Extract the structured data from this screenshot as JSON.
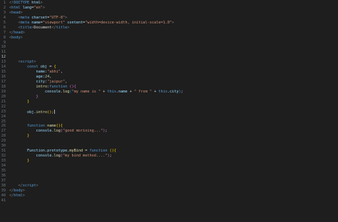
{
  "editor": {
    "active_line": 12,
    "line_numbers": [
      "1",
      "2",
      "3",
      "4",
      "5",
      "6",
      "7",
      "8",
      "9",
      "10",
      "11",
      "12",
      "13",
      "14",
      "15",
      "16",
      "17",
      "18",
      "19",
      "20",
      "21",
      "22",
      "23",
      "24",
      "25",
      "26",
      "27",
      "28",
      "29",
      "30",
      "31",
      "32",
      "33",
      "34",
      "35",
      "36",
      "37",
      "38",
      "39",
      "40",
      "41"
    ],
    "colors": {
      "background": "#1e1e1e",
      "tag": "#569cd6",
      "attribute": "#9cdcfe",
      "string": "#ce9178",
      "function": "#dcdcaa",
      "number": "#b5cea8"
    }
  },
  "code_lines": [
    [
      {
        "t": "<!",
        "c": "bracket"
      },
      {
        "t": "DOCTYPE",
        "c": "tag"
      },
      {
        "t": " ",
        "c": "punc"
      },
      {
        "t": "html",
        "c": "attr"
      },
      {
        "t": ">",
        "c": "bracket"
      }
    ],
    [
      {
        "t": "<",
        "c": "bracket"
      },
      {
        "t": "html",
        "c": "tag"
      },
      {
        "t": " ",
        "c": "punc"
      },
      {
        "t": "lang",
        "c": "attr"
      },
      {
        "t": "=",
        "c": "punc"
      },
      {
        "t": "\"en\"",
        "c": "str"
      },
      {
        "t": ">",
        "c": "bracket"
      }
    ],
    [
      {
        "t": "<",
        "c": "bracket"
      },
      {
        "t": "head",
        "c": "tag"
      },
      {
        "t": ">",
        "c": "bracket"
      }
    ],
    [
      {
        "t": "    ",
        "c": "punc"
      },
      {
        "t": "<",
        "c": "bracket"
      },
      {
        "t": "meta",
        "c": "tag"
      },
      {
        "t": " ",
        "c": "punc"
      },
      {
        "t": "charset",
        "c": "attr"
      },
      {
        "t": "=",
        "c": "punc"
      },
      {
        "t": "\"UTF-8\"",
        "c": "str"
      },
      {
        "t": ">",
        "c": "bracket"
      }
    ],
    [
      {
        "t": "    ",
        "c": "punc"
      },
      {
        "t": "<",
        "c": "bracket"
      },
      {
        "t": "meta",
        "c": "tag"
      },
      {
        "t": " ",
        "c": "punc"
      },
      {
        "t": "name",
        "c": "attr"
      },
      {
        "t": "=",
        "c": "punc"
      },
      {
        "t": "\"viewport\"",
        "c": "str"
      },
      {
        "t": " ",
        "c": "punc"
      },
      {
        "t": "content",
        "c": "attr"
      },
      {
        "t": "=",
        "c": "punc"
      },
      {
        "t": "\"width=device-width, initial-scale=1.0\"",
        "c": "str"
      },
      {
        "t": ">",
        "c": "bracket"
      }
    ],
    [
      {
        "t": "    ",
        "c": "punc"
      },
      {
        "t": "<",
        "c": "bracket"
      },
      {
        "t": "title",
        "c": "tag"
      },
      {
        "t": ">",
        "c": "bracket"
      },
      {
        "t": "Document",
        "c": "punc"
      },
      {
        "t": "</",
        "c": "bracket"
      },
      {
        "t": "title",
        "c": "tag"
      },
      {
        "t": ">",
        "c": "bracket"
      }
    ],
    [
      {
        "t": "</",
        "c": "bracket"
      },
      {
        "t": "head",
        "c": "tag"
      },
      {
        "t": ">",
        "c": "bracket"
      }
    ],
    [
      {
        "t": "<",
        "c": "bracket"
      },
      {
        "t": "body",
        "c": "tag"
      },
      {
        "t": ">",
        "c": "bracket"
      }
    ],
    [],
    [],
    [],
    [],
    [
      {
        "t": "    ",
        "c": "punc"
      },
      {
        "t": "<",
        "c": "bracket"
      },
      {
        "t": "script",
        "c": "tag"
      },
      {
        "t": ">",
        "c": "bracket"
      }
    ],
    [
      {
        "t": "        ",
        "c": "punc"
      },
      {
        "t": "const",
        "c": "kw"
      },
      {
        "t": " ",
        "c": "punc"
      },
      {
        "t": "obj",
        "c": "var"
      },
      {
        "t": " = ",
        "c": "punc"
      },
      {
        "t": "{",
        "c": "br1"
      }
    ],
    [
      {
        "t": "            ",
        "c": "punc"
      },
      {
        "t": "name",
        "c": "var"
      },
      {
        "t": ":",
        "c": "punc"
      },
      {
        "t": "\"abhi\"",
        "c": "str"
      },
      {
        "t": ",",
        "c": "punc"
      }
    ],
    [
      {
        "t": "            ",
        "c": "punc"
      },
      {
        "t": "age",
        "c": "var"
      },
      {
        "t": ":",
        "c": "punc"
      },
      {
        "t": "24",
        "c": "num"
      },
      {
        "t": ",",
        "c": "punc"
      }
    ],
    [
      {
        "t": "            ",
        "c": "punc"
      },
      {
        "t": "city",
        "c": "var"
      },
      {
        "t": ":",
        "c": "punc"
      },
      {
        "t": "\"jaipur\"",
        "c": "str"
      },
      {
        "t": ",",
        "c": "punc"
      }
    ],
    [
      {
        "t": "            ",
        "c": "punc"
      },
      {
        "t": "intro",
        "c": "fn"
      },
      {
        "t": ":",
        "c": "punc"
      },
      {
        "t": "function",
        "c": "kw"
      },
      {
        "t": " ",
        "c": "punc"
      },
      {
        "t": "()",
        "c": "br2"
      },
      {
        "t": "{",
        "c": "br2"
      }
    ],
    [
      {
        "t": "                ",
        "c": "punc"
      },
      {
        "t": "console",
        "c": "var"
      },
      {
        "t": ".",
        "c": "punc"
      },
      {
        "t": "log",
        "c": "fn"
      },
      {
        "t": "(",
        "c": "br3"
      },
      {
        "t": "\"my name is \"",
        "c": "str"
      },
      {
        "t": " + ",
        "c": "punc"
      },
      {
        "t": "this",
        "c": "this"
      },
      {
        "t": ".",
        "c": "punc"
      },
      {
        "t": "name",
        "c": "var"
      },
      {
        "t": " + ",
        "c": "punc"
      },
      {
        "t": "\" from \"",
        "c": "str"
      },
      {
        "t": " + ",
        "c": "punc"
      },
      {
        "t": "this",
        "c": "this"
      },
      {
        "t": ".",
        "c": "punc"
      },
      {
        "t": "city",
        "c": "var"
      },
      {
        "t": ")",
        "c": "br3"
      },
      {
        "t": ";",
        "c": "punc"
      }
    ],
    [
      {
        "t": "            ",
        "c": "punc"
      },
      {
        "t": "}",
        "c": "br2"
      }
    ],
    [
      {
        "t": "        ",
        "c": "punc"
      },
      {
        "t": "}",
        "c": "br1"
      }
    ],
    [],
    [
      {
        "t": "        ",
        "c": "punc"
      },
      {
        "t": "obj",
        "c": "var"
      },
      {
        "t": ".",
        "c": "punc"
      },
      {
        "t": "intro",
        "c": "fn"
      },
      {
        "t": "()",
        "c": "br1"
      },
      {
        "t": ";",
        "c": "punc"
      },
      {
        "t": "",
        "c": "caret"
      }
    ],
    [],
    [],
    [
      {
        "t": "        ",
        "c": "punc"
      },
      {
        "t": "function",
        "c": "kw"
      },
      {
        "t": " ",
        "c": "punc"
      },
      {
        "t": "name",
        "c": "fn"
      },
      {
        "t": "()",
        "c": "br1"
      },
      {
        "t": "{",
        "c": "br1"
      }
    ],
    [
      {
        "t": "            ",
        "c": "punc"
      },
      {
        "t": "console",
        "c": "var"
      },
      {
        "t": ".",
        "c": "punc"
      },
      {
        "t": "log",
        "c": "fn"
      },
      {
        "t": "(",
        "c": "br2"
      },
      {
        "t": "\"good morining...\"",
        "c": "str"
      },
      {
        "t": ")",
        "c": "br2"
      },
      {
        "t": ";",
        "c": "punc"
      }
    ],
    [
      {
        "t": "        ",
        "c": "punc"
      },
      {
        "t": "}",
        "c": "br1"
      }
    ],
    [],
    [],
    [
      {
        "t": "        ",
        "c": "punc"
      },
      {
        "t": "Function",
        "c": "var"
      },
      {
        "t": ".",
        "c": "punc"
      },
      {
        "t": "prototype",
        "c": "var"
      },
      {
        "t": ".",
        "c": "punc"
      },
      {
        "t": "myBind",
        "c": "fn"
      },
      {
        "t": " = ",
        "c": "punc"
      },
      {
        "t": "function",
        "c": "kw"
      },
      {
        "t": " ",
        "c": "punc"
      },
      {
        "t": "()",
        "c": "br1"
      },
      {
        "t": "{",
        "c": "br1"
      }
    ],
    [
      {
        "t": "            ",
        "c": "punc"
      },
      {
        "t": "console",
        "c": "var"
      },
      {
        "t": ".",
        "c": "punc"
      },
      {
        "t": "log",
        "c": "fn"
      },
      {
        "t": "(",
        "c": "br2"
      },
      {
        "t": "\"my bind method....\"",
        "c": "str"
      },
      {
        "t": ")",
        "c": "br2"
      },
      {
        "t": ";",
        "c": "punc"
      }
    ],
    [
      {
        "t": "        ",
        "c": "punc"
      },
      {
        "t": "}",
        "c": "br1"
      }
    ],
    [],
    [],
    [],
    [],
    [
      {
        "t": "    ",
        "c": "punc"
      },
      {
        "t": "</",
        "c": "bracket"
      },
      {
        "t": "script",
        "c": "tag"
      },
      {
        "t": ">",
        "c": "bracket"
      }
    ],
    [
      {
        "t": "</",
        "c": "bracket"
      },
      {
        "t": "body",
        "c": "tag"
      },
      {
        "t": ">",
        "c": "bracket"
      }
    ],
    [
      {
        "t": "</",
        "c": "bracket"
      },
      {
        "t": "html",
        "c": "tag"
      },
      {
        "t": ">",
        "c": "bracket"
      }
    ],
    []
  ]
}
